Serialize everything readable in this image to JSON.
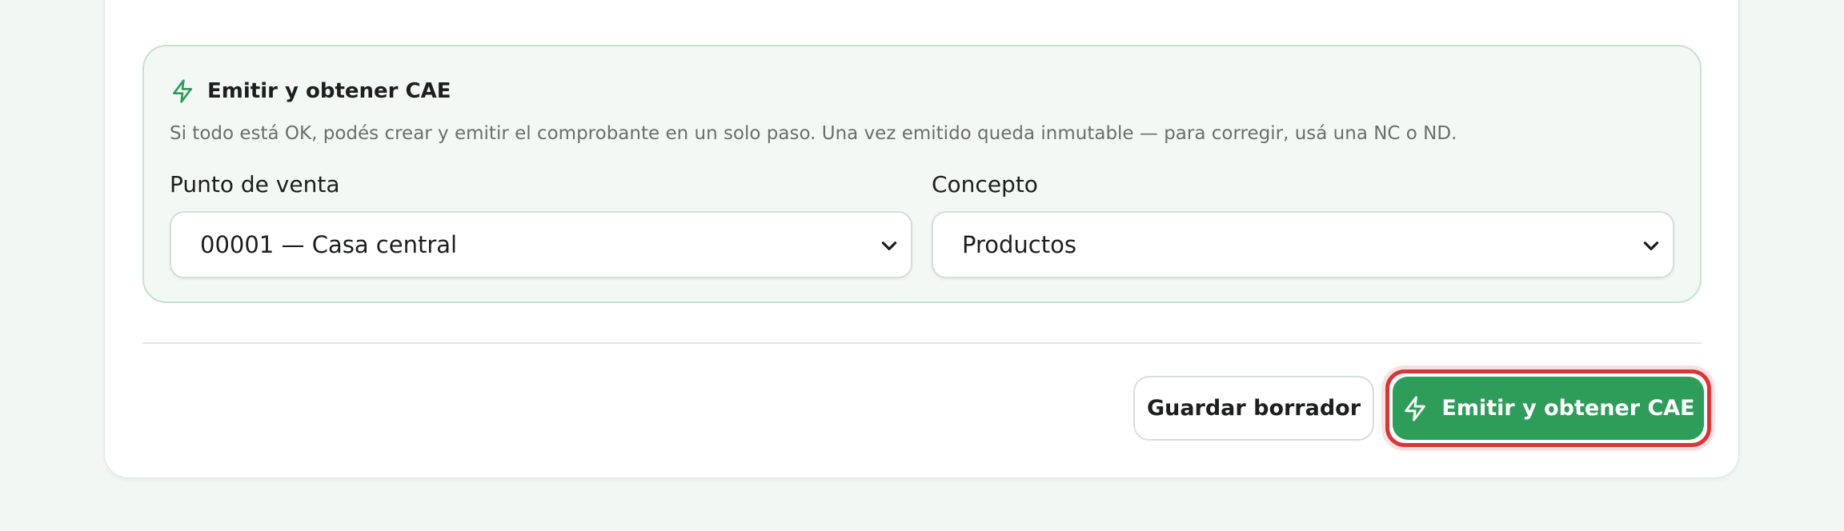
{
  "panel": {
    "title": "Emitir y obtener CAE",
    "description": "Si todo está OK, podés crear y emitir el comprobante en un solo paso. Una vez emitido queda inmutable — para corregir, usá una NC o ND.",
    "icon": "lightning-icon"
  },
  "fields": {
    "punto_de_venta": {
      "label": "Punto de venta",
      "value": "00001 — Casa central"
    },
    "concepto": {
      "label": "Concepto",
      "value": "Productos"
    }
  },
  "actions": {
    "save_draft_label": "Guardar borrador",
    "emit_label": "Emitir y obtener CAE"
  },
  "colors": {
    "accent_green": "#2e9d5a",
    "focus_ring": "#d8363a",
    "panel_bg": "#f2f8f4",
    "panel_border": "#c8e0d0"
  }
}
